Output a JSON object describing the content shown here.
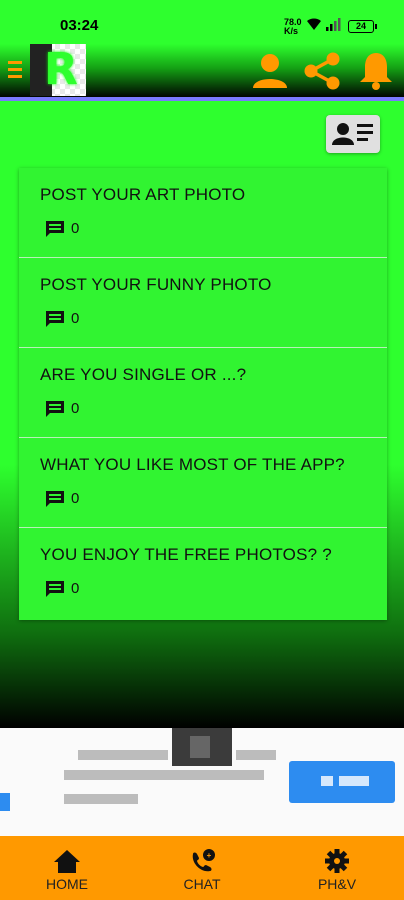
{
  "status_bar": {
    "time": "03:24",
    "network_speed_top": "78.0",
    "network_speed_bottom": "K/s",
    "battery": "24"
  },
  "app_bar": {
    "icons": [
      "menu-icon",
      "app-logo",
      "profile-icon",
      "share-icon",
      "bell-icon"
    ]
  },
  "main": {
    "card_button_icon": "contact-card-icon",
    "topics": [
      {
        "title": "POST YOUR ART PHOTO",
        "comments": "0"
      },
      {
        "title": "POST YOUR FUNNY PHOTO",
        "comments": "0"
      },
      {
        "title": "ARE YOU SINGLE OR ...?",
        "comments": "0"
      },
      {
        "title": "WHAT YOU LIKE MOST OF THE APP?",
        "comments": "0"
      },
      {
        "title": "YOU ENJOY THE FREE PHOTOS? ?",
        "comments": "0"
      }
    ]
  },
  "bottom_nav": {
    "items": [
      {
        "label": "HOME",
        "icon": "home-icon"
      },
      {
        "label": "CHAT",
        "icon": "chat-phone-icon"
      },
      {
        "label": "PH&V",
        "icon": "gear-icon"
      }
    ]
  },
  "colors": {
    "accent": "#ff9900",
    "background": "#2eff2e",
    "card": "#31f431",
    "ad_button": "#2d8cf0"
  }
}
